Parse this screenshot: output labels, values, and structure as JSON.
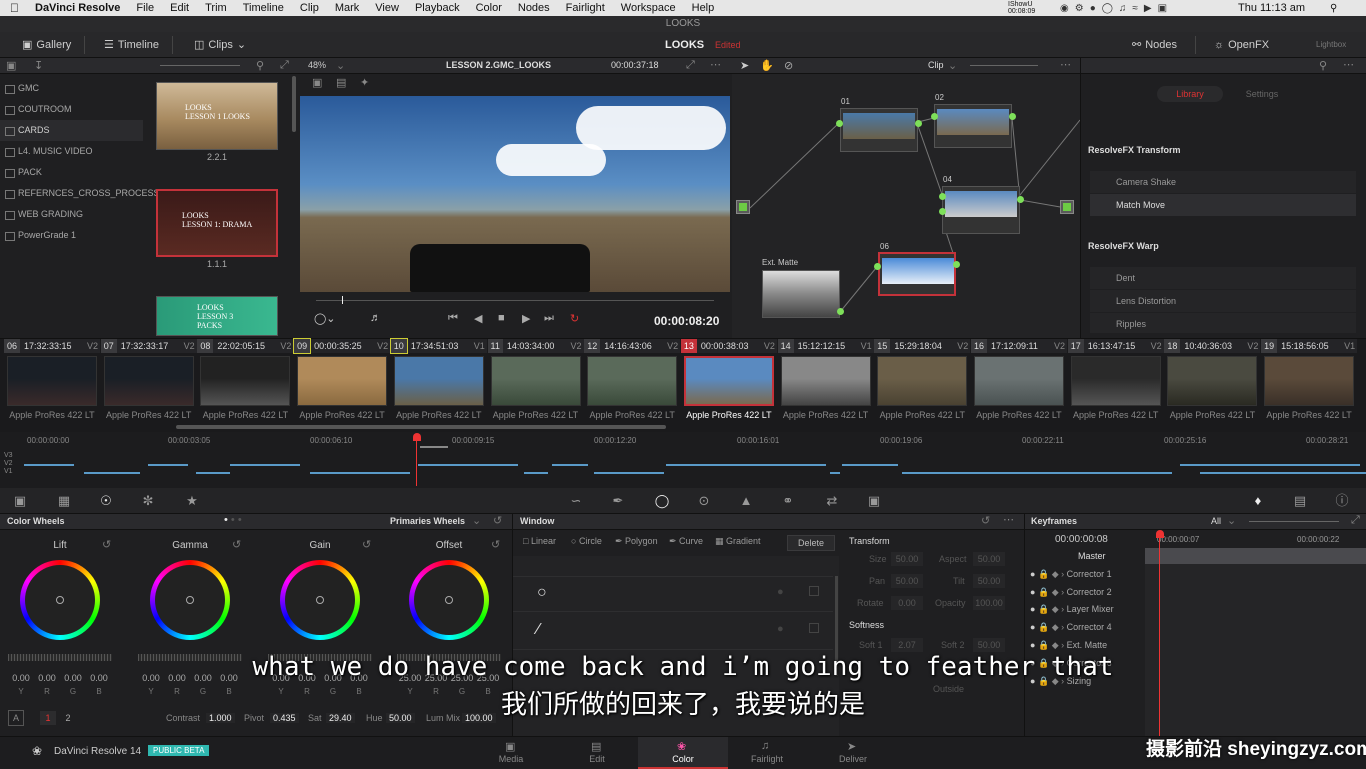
{
  "macbar": {
    "app": "DaVinci Resolve",
    "menus": [
      "File",
      "Edit",
      "Trim",
      "Timeline",
      "Clip",
      "Mark",
      "View",
      "Playback",
      "Color",
      "Nodes",
      "Fairlight",
      "Workspace",
      "Help"
    ],
    "clock": "Thu 11:13 am",
    "rec": "IShowU 00:08:09"
  },
  "window": {
    "title": "LOOKS"
  },
  "toolbar": {
    "gallery": "Gallery",
    "timeline": "Timeline",
    "clips": "Clips",
    "project": "LOOKS",
    "edited": "Edited",
    "nodes": "Nodes",
    "openfx": "OpenFX",
    "lightbox": "Lightbox"
  },
  "gallery": {
    "albums": [
      "GMC",
      "COUTROOM",
      "CARDS",
      "L4. MUSIC VIDEO",
      "PACK",
      "REFERNCES_CROSS_PROCESS",
      "WEB GRADING",
      "PowerGrade 1"
    ],
    "stills": [
      {
        "title": "LOOKS\nLESSON 1 LOOKS",
        "label": "2.2.1"
      },
      {
        "title": "LOOKS\nLESSON 1: DRAMA",
        "label": "1.1.1"
      },
      {
        "title": "LOOKS\nLESSON 3\nPACKS",
        "label": ""
      }
    ]
  },
  "viewer": {
    "zoom": "48%",
    "timeline_name": "LESSON 2.GMC_LOOKS",
    "duration": "00:00:37:18",
    "timecode": "00:00:08:20"
  },
  "nodes": {
    "mode": "Clip",
    "labels": [
      "01",
      "02",
      "04",
      "06"
    ],
    "ext_matte": "Ext. Matte"
  },
  "library": {
    "tabs": [
      "Library",
      "Settings"
    ],
    "categories": [
      {
        "name": "ResolveFX Transform",
        "items": [
          "Camera Shake",
          "Match Move"
        ]
      },
      {
        "name": "ResolveFX Warp",
        "items": [
          "Dent",
          "Lens Distortion",
          "Ripples"
        ]
      }
    ]
  },
  "clips": [
    {
      "n": "06",
      "tc": "17:32:33:15",
      "v": "V2",
      "codec": "Apple ProRes 422 LT",
      "c1": "#1a1f26",
      "c2": "#3a2a2a"
    },
    {
      "n": "07",
      "tc": "17:32:33:17",
      "v": "V2",
      "codec": "Apple ProRes 422 LT",
      "c1": "#1a1f26",
      "c2": "#3a2a2a"
    },
    {
      "n": "08",
      "tc": "22:02:05:15",
      "v": "V2",
      "codec": "Apple ProRes 422 LT",
      "c1": "#222",
      "c2": "#555"
    },
    {
      "n": "09",
      "tc": "00:00:35:25",
      "v": "V2",
      "codec": "Apple ProRes 422 LT",
      "c1": "#b08a5a",
      "c2": "#8a6a40"
    },
    {
      "n": "10",
      "tc": "17:34:51:03",
      "v": "V1",
      "codec": "Apple ProRes 422 LT",
      "c1": "#4a78a8",
      "c2": "#6a6048"
    },
    {
      "n": "11",
      "tc": "14:03:34:00",
      "v": "V2",
      "codec": "Apple ProRes 422 LT",
      "c1": "#5a6a5a",
      "c2": "#3a4a3a"
    },
    {
      "n": "12",
      "tc": "14:16:43:06",
      "v": "V2",
      "codec": "Apple ProRes 422 LT",
      "c1": "#5a6a5a",
      "c2": "#3a4a3a"
    },
    {
      "n": "13",
      "tc": "00:00:38:03",
      "v": "V2",
      "codec": "Apple ProRes 422 LT",
      "c1": "#5a8ac0",
      "c2": "#7a6a50"
    },
    {
      "n": "14",
      "tc": "15:12:12:15",
      "v": "V1",
      "codec": "Apple ProRes 422 LT",
      "c1": "#888",
      "c2": "#444"
    },
    {
      "n": "15",
      "tc": "15:29:18:04",
      "v": "V2",
      "codec": "Apple ProRes 422 LT",
      "c1": "#6a5e48",
      "c2": "#4a4232"
    },
    {
      "n": "16",
      "tc": "17:12:09:11",
      "v": "V2",
      "codec": "Apple ProRes 422 LT",
      "c1": "#6a7272",
      "c2": "#4a5252"
    },
    {
      "n": "17",
      "tc": "16:13:47:15",
      "v": "V2",
      "codec": "Apple ProRes 422 LT",
      "c1": "#2a2a2a",
      "c2": "#555"
    },
    {
      "n": "18",
      "tc": "10:40:36:03",
      "v": "V2",
      "codec": "Apple ProRes 422 LT",
      "c1": "#4a4a40",
      "c2": "#2a2a22"
    },
    {
      "n": "19",
      "tc": "15:18:56:05",
      "v": "V1",
      "codec": "Apple ProRes 422 LT",
      "c1": "#5a4a3a",
      "c2": "#3a3028"
    }
  ],
  "timeline": {
    "ticks": [
      "00:00:00:00",
      "00:00:03:05",
      "00:00:06:10",
      "00:00:09:15",
      "00:00:12:20",
      "00:00:16:01",
      "00:00:19:06",
      "00:00:22:11",
      "00:00:25:16",
      "00:00:28:21"
    ],
    "tracks": [
      "V3",
      "V2",
      "V1"
    ]
  },
  "color_wheels": {
    "title": "Color Wheels",
    "mode": "Primaries Wheels",
    "wheels": [
      "Lift",
      "Gamma",
      "Gain",
      "Offset"
    ],
    "values": [
      "0.00",
      "0.00",
      "0.00",
      "0.00"
    ],
    "offset_values": [
      "25.00",
      "25.00",
      "25.00"
    ],
    "channels": [
      "Y",
      "R",
      "G",
      "B"
    ],
    "contrast_label": "Contrast",
    "contrast": "1.000",
    "pivot_label": "Pivot",
    "pivot": "0.435",
    "sat_label": "Sat",
    "sat": "29.40",
    "hue_label": "Hue",
    "hue": "50.00",
    "lummix_label": "Lum Mix",
    "lummix": "100.00",
    "auto": "A",
    "pages": [
      "1",
      "2"
    ]
  },
  "window_panel": {
    "title": "Window",
    "tools": [
      "Linear",
      "Circle",
      "Polygon",
      "Curve",
      "Gradient"
    ],
    "delete": "Delete"
  },
  "transform": {
    "title": "Transform",
    "size_label": "Size",
    "size": "50.00",
    "aspect_label": "Aspect",
    "aspect": "50.00",
    "pan_label": "Pan",
    "pan": "50.00",
    "tilt_label": "Tilt",
    "tilt": "50.00",
    "rotate_label": "Rotate",
    "rotate": "0.00",
    "opacity_label": "Opacity",
    "opacity": "100.00",
    "softness_title": "Softness",
    "soft1_label": "Soft 1",
    "soft1": "2.07",
    "soft2_label": "Soft 2",
    "soft2": "50.00",
    "outside_label": "Outside"
  },
  "keyframes": {
    "title": "Keyframes",
    "filter": "All",
    "current": "00:00:00:08",
    "t1": "00:00:00:07",
    "t2": "00:00:00:22",
    "rows": [
      "Master",
      "Corrector 1",
      "Corrector 2",
      "Layer Mixer",
      "Corrector 4",
      "Ext. Matte",
      "Corrector 6",
      "Sizing"
    ]
  },
  "bottomnav": {
    "app": "DaVinci Resolve 14",
    "beta": "PUBLIC BETA",
    "pages": [
      "Media",
      "Edit",
      "Color",
      "Fairlight",
      "Deliver"
    ]
  },
  "subtitles": {
    "en": "what we do have come back and i’m going to feather that",
    "zh": "我们所做的回来了，我要说的是",
    "watermark": "摄影前沿 sheyingzyz.com"
  }
}
